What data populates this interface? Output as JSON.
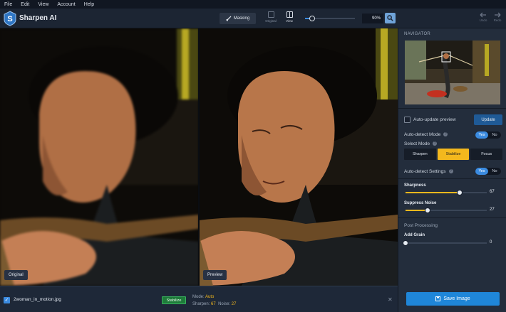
{
  "menu": [
    "File",
    "Edit",
    "View",
    "Account",
    "Help"
  ],
  "app": {
    "name": "Sharpen AI"
  },
  "toolbar": {
    "masking_label": "Masking",
    "original_label": "Original",
    "view_label": "View",
    "zoom_value": "90%",
    "zoom_level_fraction": 0.14,
    "undo_label": "Undo",
    "redo_label": "Redo"
  },
  "viewer": {
    "left_label": "Original",
    "right_label": "Preview"
  },
  "filmstrip": {
    "filename": "2woman_in_motion.jpg",
    "badge": "Stabilize",
    "mode_label": "Mode:",
    "mode_value": "Auto",
    "sharpen_label": "Sharpen:",
    "sharpen_value": "67",
    "noise_label": "Noise:",
    "noise_value": "27"
  },
  "sidebar": {
    "navigator_title": "NAVIGATOR",
    "auto_update_label": "Auto-update preview",
    "update_button": "Update",
    "auto_detect_mode_label": "Auto-detect Mode",
    "yes": "Yes",
    "no": "No",
    "select_mode_label": "Select Mode",
    "modes": [
      "Sharpen",
      "Stabilize",
      "Focus"
    ],
    "active_mode": "Stabilize",
    "auto_detect_settings_label": "Auto-detect Settings",
    "sharpness": {
      "label": "Sharpness",
      "value": "67",
      "fraction": 0.67
    },
    "suppress_noise": {
      "label": "Suppress Noise",
      "value": "27",
      "fraction": 0.27
    },
    "post_processing_label": "Post Processing",
    "add_grain": {
      "label": "Add Grain",
      "value": "0",
      "fraction": 0.0
    },
    "save_button": "Save Image"
  },
  "colors": {
    "accent": "#3b8be0",
    "highlight": "#f3b81d",
    "stabilize_badge": "#1e7b3a"
  }
}
